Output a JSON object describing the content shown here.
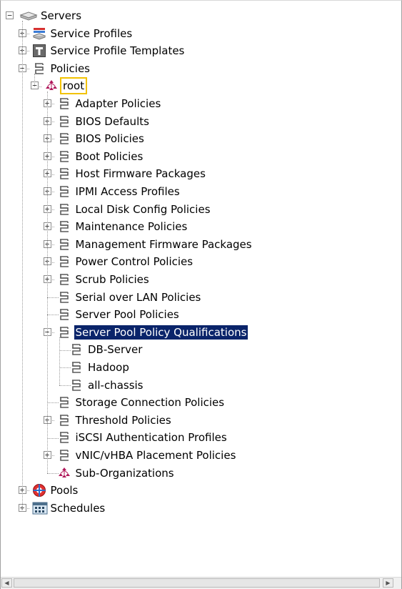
{
  "tree": {
    "nodes": [
      {
        "label": "Servers",
        "level": 0,
        "expander": "minus",
        "icon": "server-icon",
        "name": "servers"
      },
      {
        "label": "Service Profiles",
        "level": 1,
        "expander": "plus",
        "icon": "service-profile-icon",
        "name": "service-profiles"
      },
      {
        "label": "Service Profile Templates",
        "level": 1,
        "expander": "plus",
        "icon": "template-icon",
        "name": "service-profile-templates"
      },
      {
        "label": "Policies",
        "level": 1,
        "expander": "minus",
        "icon": "policy-icon",
        "name": "policies"
      },
      {
        "label": "root",
        "level": 2,
        "expander": "minus",
        "icon": "org-icon",
        "name": "root",
        "focused": true
      },
      {
        "label": "Adapter Policies",
        "level": 3,
        "expander": "plus",
        "icon": "policy-icon",
        "name": "adapter-policies"
      },
      {
        "label": "BIOS Defaults",
        "level": 3,
        "expander": "plus",
        "icon": "policy-icon",
        "name": "bios-defaults"
      },
      {
        "label": "BIOS Policies",
        "level": 3,
        "expander": "plus",
        "icon": "policy-icon",
        "name": "bios-policies"
      },
      {
        "label": "Boot Policies",
        "level": 3,
        "expander": "plus",
        "icon": "policy-icon",
        "name": "boot-policies"
      },
      {
        "label": "Host Firmware Packages",
        "level": 3,
        "expander": "plus",
        "icon": "policy-icon",
        "name": "host-firmware-packages"
      },
      {
        "label": "IPMI Access Profiles",
        "level": 3,
        "expander": "plus",
        "icon": "policy-icon",
        "name": "ipmi-access-profiles"
      },
      {
        "label": "Local Disk Config Policies",
        "level": 3,
        "expander": "plus",
        "icon": "policy-icon",
        "name": "local-disk-config-policies"
      },
      {
        "label": "Maintenance Policies",
        "level": 3,
        "expander": "plus",
        "icon": "policy-icon",
        "name": "maintenance-policies"
      },
      {
        "label": "Management Firmware Packages",
        "level": 3,
        "expander": "plus",
        "icon": "policy-icon",
        "name": "management-firmware-packages"
      },
      {
        "label": "Power Control Policies",
        "level": 3,
        "expander": "plus",
        "icon": "policy-icon",
        "name": "power-control-policies"
      },
      {
        "label": "Scrub Policies",
        "level": 3,
        "expander": "plus",
        "icon": "policy-icon",
        "name": "scrub-policies"
      },
      {
        "label": "Serial over LAN Policies",
        "level": 3,
        "expander": "none",
        "icon": "policy-icon",
        "name": "serial-over-lan-policies"
      },
      {
        "label": "Server Pool Policies",
        "level": 3,
        "expander": "none",
        "icon": "policy-icon",
        "name": "server-pool-policies"
      },
      {
        "label": "Server Pool Policy Qualifications",
        "level": 3,
        "expander": "minus",
        "icon": "policy-icon",
        "name": "server-pool-policy-qualifications",
        "selected": true
      },
      {
        "label": "DB-Server",
        "level": 4,
        "expander": "none",
        "icon": "policy-icon",
        "name": "db-server"
      },
      {
        "label": "Hadoop",
        "level": 4,
        "expander": "none",
        "icon": "policy-icon",
        "name": "hadoop"
      },
      {
        "label": "all-chassis",
        "level": 4,
        "expander": "none",
        "icon": "policy-icon",
        "name": "all-chassis"
      },
      {
        "label": "Storage Connection Policies",
        "level": 3,
        "expander": "none",
        "icon": "policy-icon",
        "name": "storage-connection-policies"
      },
      {
        "label": "Threshold Policies",
        "level": 3,
        "expander": "plus",
        "icon": "policy-icon",
        "name": "threshold-policies"
      },
      {
        "label": "iSCSI Authentication Profiles",
        "level": 3,
        "expander": "none",
        "icon": "policy-icon",
        "name": "iscsi-authentication-profiles"
      },
      {
        "label": "vNIC/vHBA Placement Policies",
        "level": 3,
        "expander": "plus",
        "icon": "policy-icon",
        "name": "vnic-vhba-placement-policies"
      },
      {
        "label": "Sub-Organizations",
        "level": 3,
        "expander": "none",
        "icon": "org-icon",
        "name": "sub-organizations"
      },
      {
        "label": "Pools",
        "level": 1,
        "expander": "plus",
        "icon": "pool-icon",
        "name": "pools"
      },
      {
        "label": "Schedules",
        "level": 1,
        "expander": "plus",
        "icon": "schedule-icon",
        "name": "schedules"
      }
    ]
  },
  "scrollbar": {
    "left_arrow": "◀",
    "right_arrow": "▶"
  },
  "colors": {
    "selection_bg": "#0a246a",
    "focus_outline": "#f2c200",
    "policy_icon": "#5a5a5a",
    "org_icon": "#b0185a"
  }
}
